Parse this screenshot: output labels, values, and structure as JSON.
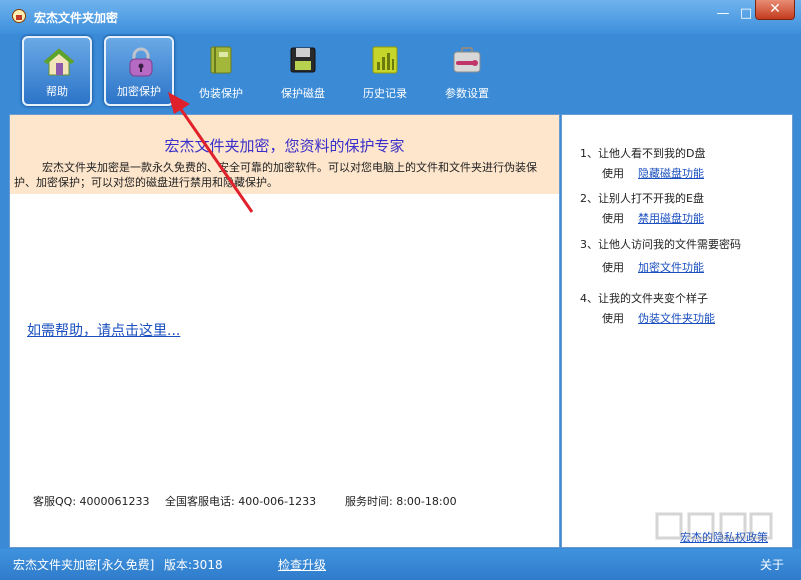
{
  "window": {
    "title": "宏杰文件夹加密"
  },
  "toolbar": {
    "items": [
      {
        "label": "帮助"
      },
      {
        "label": "加密保护"
      },
      {
        "label": "伪装保护"
      },
      {
        "label": "保护磁盘"
      },
      {
        "label": "历史记录"
      },
      {
        "label": "参数设置"
      }
    ]
  },
  "banner": {
    "title": "宏杰文件夹加密，您资料的保护专家",
    "description": "宏杰文件夹加密是一款永久免费的、安全可靠的加密软件。可以对您电脑上的文件和文件夹进行伪装保护、加密保护；可以对您的磁盘进行禁用和隐藏保护。"
  },
  "main": {
    "help_link": "如需帮助，请点击这里..."
  },
  "contact": {
    "qq": "客服QQ: 4000061233",
    "phone": "全国客服电话: 400-006-1233",
    "hours": "服务时间: 8:00-18:00"
  },
  "tips": [
    {
      "question": "1、让他人看不到我的D盘",
      "use": "使用",
      "link": "隐藏磁盘功能"
    },
    {
      "question": "2、让别人打不开我的E盘",
      "use": "使用",
      "link": "禁用磁盘功能"
    },
    {
      "question": "3、让他人访问我的文件需要密码",
      "use": "使用",
      "link": "加密文件功能"
    },
    {
      "question": "4、让我的文件夹变个样子",
      "use": "使用",
      "link": "伪装文件夹功能"
    }
  ],
  "privacy_link": "宏杰的隐私权政策",
  "status": {
    "product": "宏杰文件夹加密[永久免费]",
    "version": "版本:3018",
    "update_link": "检查升级",
    "about": "关于"
  },
  "colors": {
    "accent": "#3a8ad6",
    "banner_bg": "#fde6cc",
    "link": "#1a4fbf",
    "arrow": "#e0202a"
  }
}
